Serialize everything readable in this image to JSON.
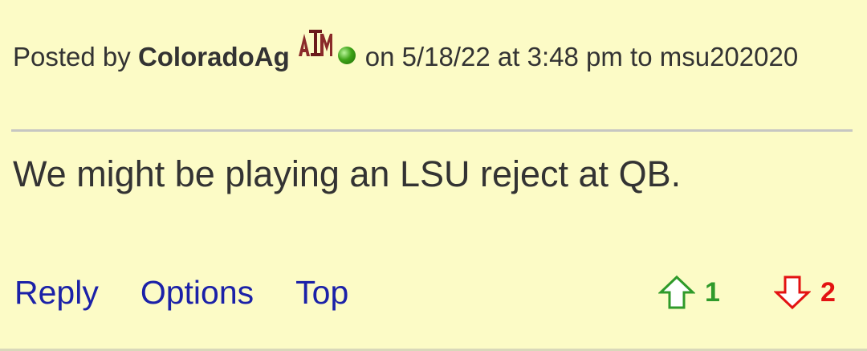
{
  "post": {
    "posted_by_label": "Posted by",
    "author": "ColoradoAg",
    "logo_icon": "texas-am-logo",
    "status_icon": "online-status-dot",
    "on_label": "on",
    "datetime": "5/18/22 at 3:48 pm",
    "to_label": "to",
    "recipient": "msu202020",
    "body": "We might be playing an LSU reject at QB."
  },
  "actions": {
    "reply": "Reply",
    "options": "Options",
    "top": "Top"
  },
  "votes": {
    "up_count": "1",
    "down_count": "2",
    "up_color": "#2f9a2a",
    "down_color": "#e31212"
  },
  "colors": {
    "background": "#fcfbc6",
    "text": "#333333",
    "link": "#1b21a8",
    "divider": "#c6c6c2"
  }
}
